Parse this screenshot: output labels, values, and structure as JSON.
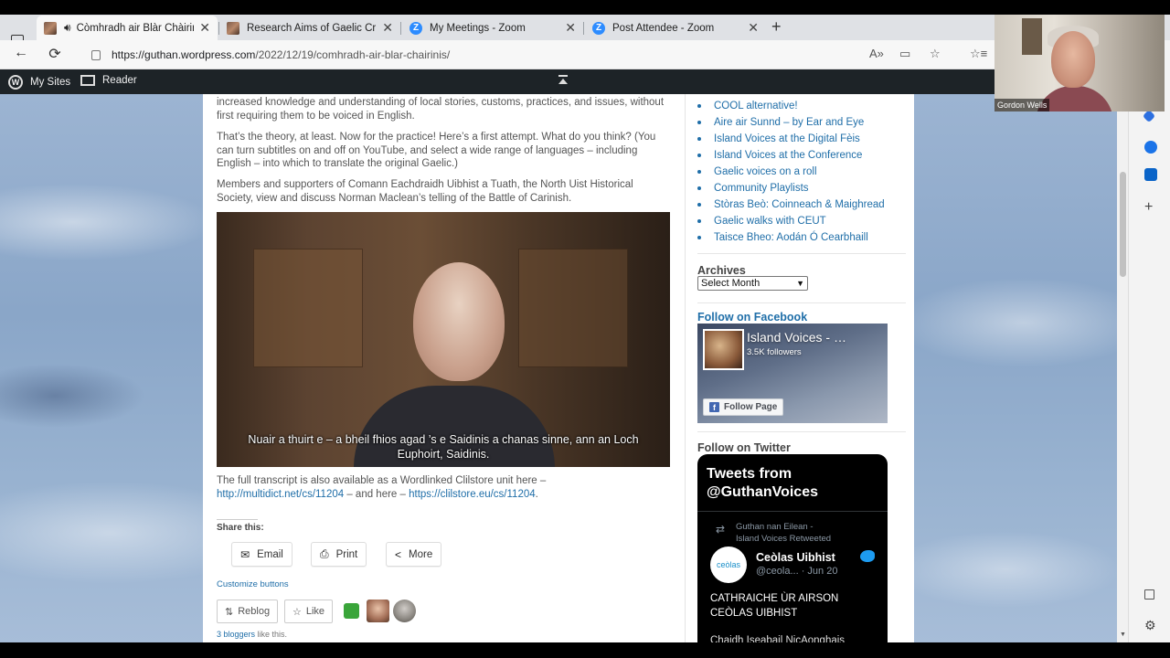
{
  "browser": {
    "tabs": [
      {
        "label": "Còmhradh air Blàr Chàirinis",
        "active": true,
        "icon": "site-favicon"
      },
      {
        "label": "Research Aims of Gaelic Crisis in",
        "active": false,
        "icon": "site-favicon"
      },
      {
        "label": "My Meetings - Zoom",
        "active": false,
        "icon": "zoom-favicon"
      },
      {
        "label": "Post Attendee - Zoom",
        "active": false,
        "icon": "zoom-favicon"
      }
    ],
    "url_host": "https://guthan.wordpress.com",
    "url_path": "/2022/12/19/comhradh-air-blar-chairinis/",
    "new_tab_glyph": "+",
    "close_glyph": "✕",
    "zoom_glyph": "Z"
  },
  "wpbar": {
    "my_sites": "My Sites",
    "reader": "Reader",
    "wp_glyph": "W"
  },
  "post": {
    "p1": "increased knowledge and understanding of local stories, customs, practices, and issues, without first requiring them to be voiced in English.",
    "p2": "That’s the theory, at least. Now for the practice! Here’s a first attempt. What do you think? (You can turn subtitles on and off on YouTube, and select a wide range of languages – including English – into which to translate the original Gaelic.)",
    "p3": "Members and supporters of Comann Eachdraidh Uibhist a Tuath, the North Uist Historical Society, view and discuss Norman Maclean’s telling of the Battle of Carinish.",
    "video_subtitle_1": "Nuair a thuirt e – a bheil fhios agad ’s e Saidinis a chanas sinne, ann an Loch",
    "video_subtitle_2": "Euphoirt, Saidinis.",
    "transcript_prefix": "The full transcript is also available as a Wordlinked Clilstore unit here –",
    "transcript_link1": "http://multidict.net/cs/11204",
    "transcript_mid": " – and here – ",
    "transcript_link2": "https://clilstore.eu/cs/11204",
    "transcript_end": "."
  },
  "share": {
    "label": "Share this:",
    "buttons": [
      "Email",
      "Print",
      "More"
    ],
    "customize": "Customize buttons",
    "reblog": "Reblog",
    "like": "Like",
    "bloggers_count": "3 bloggers",
    "bloggers_suffix": " like this."
  },
  "sidebar": {
    "recent_posts": [
      "COOL alternative!",
      "Aire air Sunnd – by Ear and Eye",
      "Island Voices at the Digital Fèis",
      "Island Voices at the Conference",
      "Gaelic voices on a roll",
      "Community Playlists",
      "Stòras Beò: Coinneach & Maighread",
      "Gaelic walks with CEUT",
      "Taisce Bheo: Aodán Ó Cearbhaill"
    ],
    "archives_title": "Archives",
    "archives_select": "Select Month",
    "facebook_title": "Follow on Facebook",
    "fb_page_name": "Island Voices - …",
    "fb_followers": "3.5K followers",
    "fb_follow_btn": "Follow Page",
    "twitter_title": "Follow on Twitter",
    "tw_header": "Tweets from @GuthanVoices",
    "tw_retweet_line1": "Guthan nan Eilean -",
    "tw_retweet_line2": "Island Voices Retweeted",
    "tw_user": "Ceòlas Uibhist",
    "tw_handle": "@ceola... · Jun 20",
    "tw_avatar_text": "ceòlas",
    "tw_text": "CATHRAICHE ÙR AIRSON CEÒLAS UIBHIST",
    "tw_text2": "Chaidh Iseabail NicAonghais"
  },
  "webcam": {
    "name": "Gordon Wells"
  }
}
